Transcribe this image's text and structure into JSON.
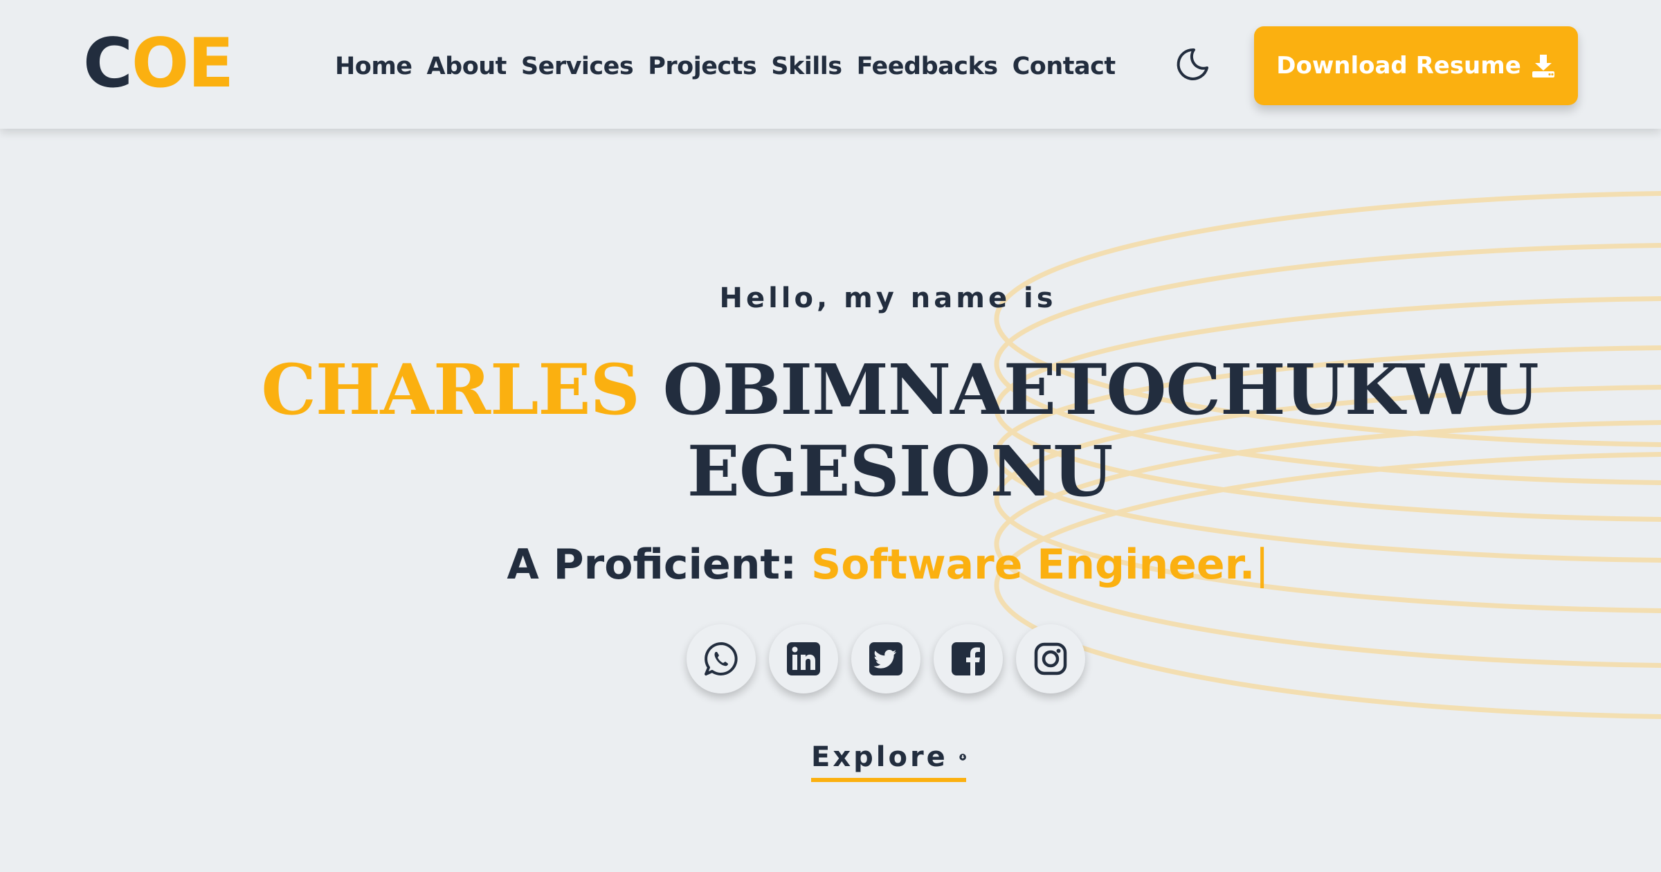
{
  "brand": {
    "logo_first": "C",
    "logo_rest": "OE"
  },
  "nav": {
    "items": [
      "Home",
      "About",
      "Services",
      "Projects",
      "Skills",
      "Feedbacks",
      "Contact"
    ]
  },
  "header": {
    "download_label": "Download Resume",
    "theme_icon": "moon-icon",
    "download_icon": "download-icon"
  },
  "hero": {
    "greeting": "Hello, my name is",
    "first_name": "CHARLES",
    "rest_name_line1": " OBIMNAETOCHUKWU",
    "rest_name_line2": "EGESIONU",
    "proficient_label": "A Proficient: ",
    "role": "Software Engineer.",
    "cursor": "|",
    "explore_label": "Explore",
    "explore_icon": "arrow-down-circle-icon"
  },
  "socials": [
    "whatsapp-icon",
    "linkedin-icon",
    "twitter-icon",
    "facebook-icon",
    "instagram-icon"
  ],
  "colors": {
    "accent": "#fbb010",
    "text": "#222d3e",
    "background": "#ebeef1"
  }
}
